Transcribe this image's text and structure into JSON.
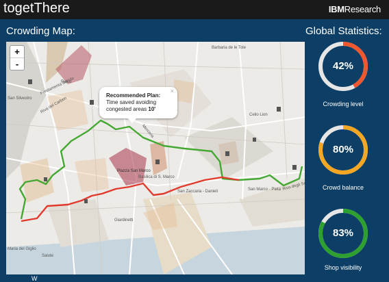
{
  "header": {
    "app_title": "togetThere",
    "brand_prefix": "IBM",
    "brand_suffix": "Research"
  },
  "map_section": {
    "title": "Crowding Map:",
    "zoom_in": "+",
    "zoom_out": "-"
  },
  "popup": {
    "title": "Recommended Plan:",
    "line1": "Time saved avoiding",
    "line2_prefix": "congested areas ",
    "line2_value": "10'",
    "close": "×"
  },
  "map_labels": {
    "rialto": "Rialto",
    "fondamenta": "Fondamenta del Vin",
    "san_silvestro": "San Silvestro",
    "riva_carbon": "Riva del Carbon",
    "piazza_san_marco": "Piazza San Marco",
    "san_zaccaria": "San Zaccaria - Danieli",
    "san_marco_pieta": "San Marco - Pieta",
    "riva_schiavoni": "Riva degli Schiavoni",
    "giardinetti": "Giardinetti",
    "maria_giglio": "Maria del Giglio",
    "salute": "Salute",
    "celio_lion": "Celio Lion",
    "barbaria": "Barbaria de le Tole",
    "basilica": "Basilica di S. Marco",
    "merceria": "Merceria"
  },
  "stats_section": {
    "title": "Global Statistics:"
  },
  "gauges": [
    {
      "value": "42%",
      "fraction": 0.42,
      "color": "#f0572f",
      "label": "Crowding level"
    },
    {
      "value": "80%",
      "fraction": 0.8,
      "color": "#f5a623",
      "label": "Crowd balance"
    },
    {
      "value": "83%",
      "fraction": 0.83,
      "color": "#2ea02f",
      "label": "Shop visibility"
    }
  ],
  "footer": {
    "partial_text": "W"
  },
  "colors": {
    "recommended_route": "#44a832",
    "standard_route": "#e2392d"
  }
}
